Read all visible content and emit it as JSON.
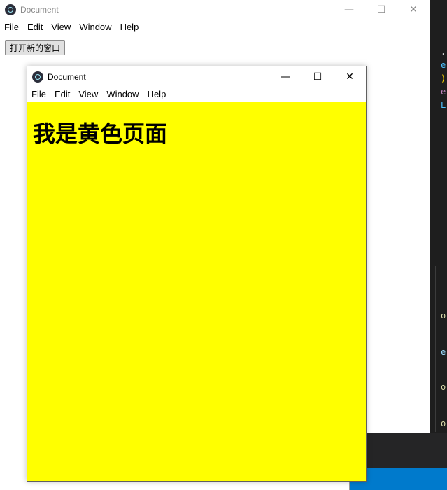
{
  "main_window": {
    "title": "Document",
    "controls": {
      "minimize": "—",
      "maximize": "☐",
      "close": "✕"
    },
    "menu": [
      "File",
      "Edit",
      "View",
      "Window",
      "Help"
    ],
    "open_button_label": "打开新的窗口"
  },
  "child_window": {
    "title": "Document",
    "controls": {
      "minimize": "—",
      "maximize": "☐",
      "close": "✕"
    },
    "menu": [
      "File",
      "Edit",
      "View",
      "Window",
      "Help"
    ],
    "page": {
      "background_color": "#ffff00",
      "heading": "我是黄色页面"
    }
  },
  "background_editor": {
    "lines": [
      {
        "text": ".",
        "color": "#d4d4d4"
      },
      {
        "text": "e",
        "color": "#4fc1ff"
      },
      {
        "text": ")",
        "color": "#ffd700"
      },
      {
        "text": "e",
        "color": "#c586c0"
      },
      {
        "text": "L",
        "color": "#4fc1ff"
      },
      {
        "text": "o",
        "color": "#dcdcaa"
      },
      {
        "text": "e",
        "color": "#9cdcfe"
      },
      {
        "text": "o",
        "color": "#dcdcaa"
      },
      {
        "text": "o",
        "color": "#dcdcaa"
      }
    ]
  }
}
